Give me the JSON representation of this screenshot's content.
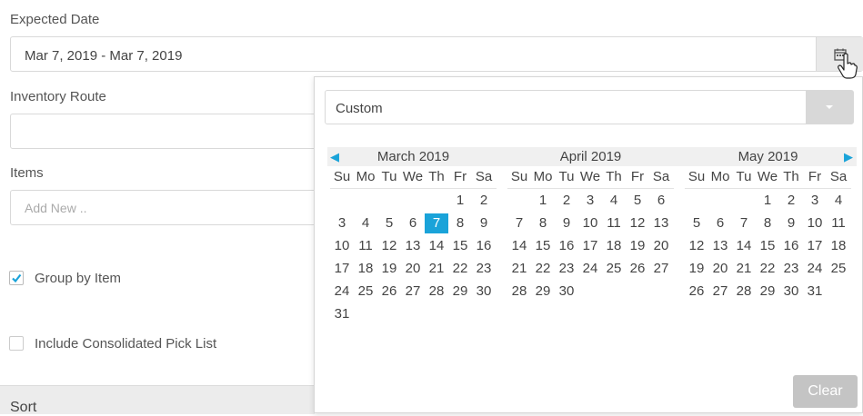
{
  "expected_date": {
    "label": "Expected Date",
    "value": "Mar 7, 2019 - Mar 7, 2019"
  },
  "inventory_route": {
    "label": "Inventory Route",
    "value": ""
  },
  "items": {
    "label": "Items",
    "placeholder": "Add New .."
  },
  "group_by_item": {
    "label": "Group by Item",
    "checked": true
  },
  "consolidated": {
    "label": "Include Consolidated Pick List",
    "checked": false
  },
  "sort": {
    "label": "Sort"
  },
  "picker": {
    "preset": "Custom",
    "clear_label": "Clear",
    "weekdays": [
      "Su",
      "Mo",
      "Tu",
      "We",
      "Th",
      "Fr",
      "Sa"
    ],
    "selected_day": 7,
    "months": [
      {
        "title": "March 2019",
        "first_weekday": 5,
        "days": 31
      },
      {
        "title": "April 2019",
        "first_weekday": 1,
        "days": 30
      },
      {
        "title": "May 2019",
        "first_weekday": 3,
        "days": 31
      }
    ]
  },
  "colors": {
    "accent": "#1aa3d9",
    "clear_button": "#c4c4c4"
  }
}
